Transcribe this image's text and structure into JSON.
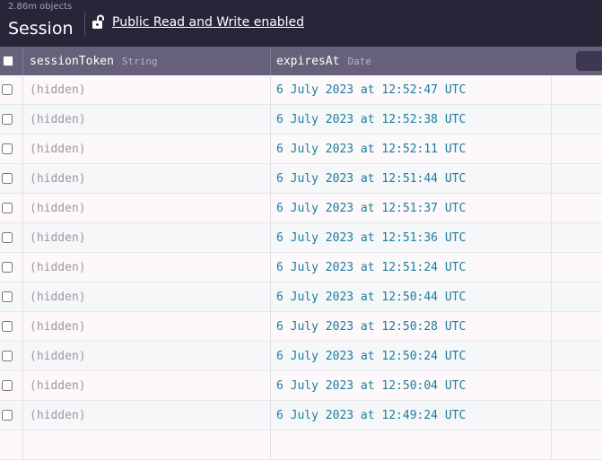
{
  "header": {
    "object_count": "2.86m objects",
    "class_name": "Session",
    "permission_label": "Public Read and Write enabled",
    "permission_icon": "unlocked-icon"
  },
  "columns": [
    {
      "name": "sessionToken",
      "type": "String"
    },
    {
      "name": "expiresAt",
      "type": "Date"
    }
  ],
  "rows": [
    {
      "sessionToken": "(hidden)",
      "expiresAt": "6 July 2023 at 12:52:47 UTC"
    },
    {
      "sessionToken": "(hidden)",
      "expiresAt": "6 July 2023 at 12:52:38 UTC"
    },
    {
      "sessionToken": "(hidden)",
      "expiresAt": "6 July 2023 at 12:52:11 UTC"
    },
    {
      "sessionToken": "(hidden)",
      "expiresAt": "6 July 2023 at 12:51:44 UTC"
    },
    {
      "sessionToken": "(hidden)",
      "expiresAt": "6 July 2023 at 12:51:37 UTC"
    },
    {
      "sessionToken": "(hidden)",
      "expiresAt": "6 July 2023 at 12:51:36 UTC"
    },
    {
      "sessionToken": "(hidden)",
      "expiresAt": "6 July 2023 at 12:51:24 UTC"
    },
    {
      "sessionToken": "(hidden)",
      "expiresAt": "6 July 2023 at 12:50:44 UTC"
    },
    {
      "sessionToken": "(hidden)",
      "expiresAt": "6 July 2023 at 12:50:28 UTC"
    },
    {
      "sessionToken": "(hidden)",
      "expiresAt": "6 July 2023 at 12:50:24 UTC"
    },
    {
      "sessionToken": "(hidden)",
      "expiresAt": "6 July 2023 at 12:50:04 UTC"
    },
    {
      "sessionToken": "(hidden)",
      "expiresAt": "6 July 2023 at 12:49:24 UTC"
    }
  ],
  "colors": {
    "toolbar_bg": "#2a2439",
    "header_bg": "#66607a",
    "date_text": "#1b7d9c",
    "hidden_text": "#9b98a3"
  }
}
